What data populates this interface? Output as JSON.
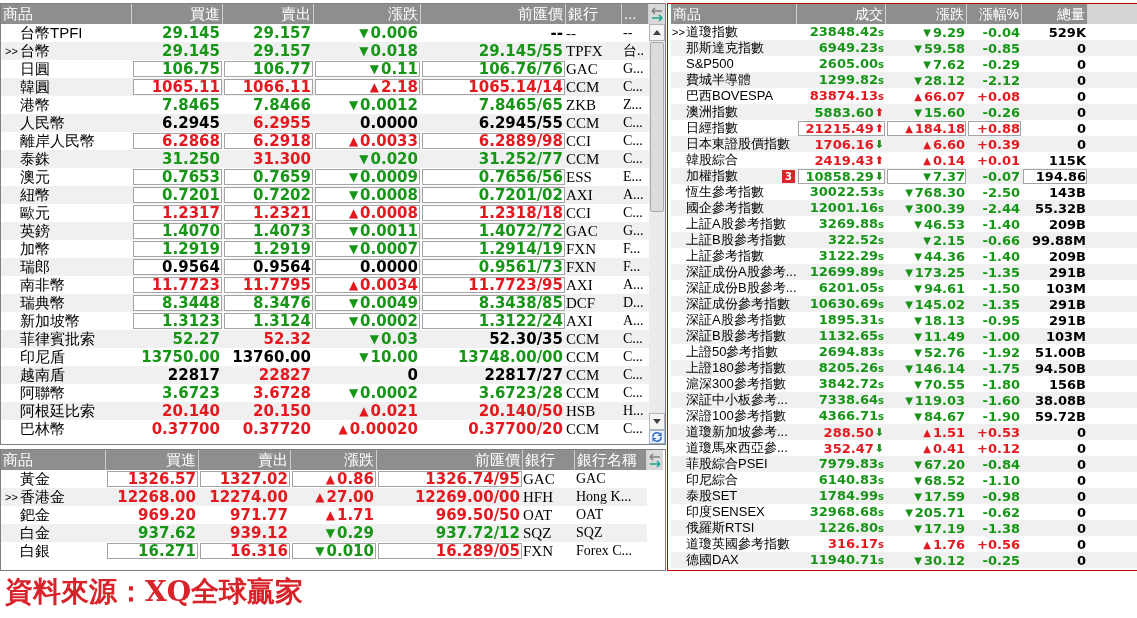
{
  "currency_table": {
    "columns": [
      "商品",
      "買進",
      "賣出",
      "漲跌",
      "前匯價",
      "銀行",
      "..."
    ],
    "selected_marker": ">>",
    "rows": [
      {
        "name": "台幣TPFI",
        "selected": false,
        "boxed": false,
        "bid": {
          "text": "29.145",
          "color": "#179517"
        },
        "ask": {
          "text": "29.157",
          "color": "#179517"
        },
        "change": {
          "text": "0.006",
          "arrow": "▼",
          "color": "#179517"
        },
        "prev": {
          "text": "--",
          "color": "#000000"
        },
        "bank": "--",
        "bank_name": "--"
      },
      {
        "name": "台幣",
        "selected": true,
        "boxed": false,
        "bid": {
          "text": "29.145",
          "color": "#179517"
        },
        "ask": {
          "text": "29.157",
          "color": "#179517"
        },
        "change": {
          "text": "0.018",
          "arrow": "▼",
          "color": "#179517"
        },
        "prev": {
          "text": "29.145/55",
          "color": "#179517"
        },
        "bank": "TPFX",
        "bank_name": "台.."
      },
      {
        "name": "日圓",
        "selected": false,
        "boxed": true,
        "bid": {
          "text": "106.75",
          "color": "#179517"
        },
        "ask": {
          "text": "106.77",
          "color": "#179517"
        },
        "change": {
          "text": "0.11",
          "arrow": "▼",
          "color": "#179517"
        },
        "prev": {
          "text": "106.76/76",
          "color": "#179517"
        },
        "bank": "GAC",
        "bank_name": "G..."
      },
      {
        "name": "韓圓",
        "selected": false,
        "boxed": true,
        "bid": {
          "text": "1065.11",
          "color": "#e3191f"
        },
        "ask": {
          "text": "1066.11",
          "color": "#e3191f"
        },
        "change": {
          "text": "2.18",
          "arrow": "▲",
          "color": "#e3191f"
        },
        "prev": {
          "text": "1065.14/14",
          "color": "#e3191f"
        },
        "bank": "CCM",
        "bank_name": "C..."
      },
      {
        "name": "港幣",
        "selected": false,
        "boxed": false,
        "bid": {
          "text": "7.8465",
          "color": "#179517"
        },
        "ask": {
          "text": "7.8466",
          "color": "#179517"
        },
        "change": {
          "text": "0.0012",
          "arrow": "▼",
          "color": "#179517"
        },
        "prev": {
          "text": "7.8465/65",
          "color": "#179517"
        },
        "bank": "ZKB",
        "bank_name": "Z..."
      },
      {
        "name": "人民幣",
        "selected": false,
        "boxed": false,
        "bid": {
          "text": "6.2945",
          "color": "#000000"
        },
        "ask": {
          "text": "6.2955",
          "color": "#e3191f"
        },
        "change": {
          "text": "0.0000",
          "color": "#000000"
        },
        "prev": {
          "text": "6.2945/55",
          "color": "#000000"
        },
        "bank": "CCM",
        "bank_name": "C..."
      },
      {
        "name": "離岸人民幣",
        "selected": false,
        "boxed": true,
        "bid": {
          "text": "6.2868",
          "color": "#e3191f"
        },
        "ask": {
          "text": "6.2918",
          "color": "#e3191f"
        },
        "change": {
          "text": "0.0033",
          "arrow": "▲",
          "color": "#e3191f"
        },
        "prev": {
          "text": "6.2889/98",
          "color": "#e3191f"
        },
        "bank": "CCI",
        "bank_name": "C..."
      },
      {
        "name": "泰銖",
        "selected": false,
        "boxed": false,
        "bid": {
          "text": "31.250",
          "color": "#179517"
        },
        "ask": {
          "text": "31.300",
          "color": "#e3191f"
        },
        "change": {
          "text": "0.020",
          "arrow": "▼",
          "color": "#179517"
        },
        "prev": {
          "text": "31.252/77",
          "color": "#179517"
        },
        "bank": "CCM",
        "bank_name": "C..."
      },
      {
        "name": "澳元",
        "selected": false,
        "boxed": true,
        "bid": {
          "text": "0.7653",
          "color": "#179517"
        },
        "ask": {
          "text": "0.7659",
          "color": "#179517"
        },
        "change": {
          "text": "0.0009",
          "arrow": "▼",
          "color": "#179517"
        },
        "prev": {
          "text": "0.7656/56",
          "color": "#179517"
        },
        "bank": "ESS",
        "bank_name": "E..."
      },
      {
        "name": "紐幣",
        "selected": false,
        "boxed": true,
        "bid": {
          "text": "0.7201",
          "color": "#179517"
        },
        "ask": {
          "text": "0.7202",
          "color": "#179517"
        },
        "change": {
          "text": "0.0008",
          "arrow": "▼",
          "color": "#179517"
        },
        "prev": {
          "text": "0.7201/02",
          "color": "#179517"
        },
        "bank": "AXI",
        "bank_name": "A..."
      },
      {
        "name": "歐元",
        "selected": false,
        "boxed": true,
        "bid": {
          "text": "1.2317",
          "color": "#e3191f"
        },
        "ask": {
          "text": "1.2321",
          "color": "#e3191f"
        },
        "change": {
          "text": "0.0008",
          "arrow": "▲",
          "color": "#e3191f"
        },
        "prev": {
          "text": "1.2318/18",
          "color": "#e3191f"
        },
        "bank": "CCI",
        "bank_name": "C..."
      },
      {
        "name": "英鎊",
        "selected": false,
        "boxed": true,
        "bid": {
          "text": "1.4070",
          "color": "#179517"
        },
        "ask": {
          "text": "1.4073",
          "color": "#179517"
        },
        "change": {
          "text": "0.0011",
          "arrow": "▼",
          "color": "#179517"
        },
        "prev": {
          "text": "1.4072/72",
          "color": "#179517"
        },
        "bank": "GAC",
        "bank_name": "G..."
      },
      {
        "name": "加幣",
        "selected": false,
        "boxed": true,
        "bid": {
          "text": "1.2919",
          "color": "#179517"
        },
        "ask": {
          "text": "1.2919",
          "color": "#179517"
        },
        "change": {
          "text": "0.0007",
          "arrow": "▼",
          "color": "#179517"
        },
        "prev": {
          "text": "1.2914/19",
          "color": "#179517"
        },
        "bank": "FXN",
        "bank_name": "F..."
      },
      {
        "name": "瑞郎",
        "selected": false,
        "boxed": true,
        "bid": {
          "text": "0.9564",
          "color": "#000000"
        },
        "ask": {
          "text": "0.9564",
          "color": "#000000"
        },
        "change": {
          "text": "0.0000",
          "color": "#000000"
        },
        "prev": {
          "text": "0.9561/73",
          "color": "#179517"
        },
        "bank": "FXN",
        "bank_name": "F..."
      },
      {
        "name": "南非幣",
        "selected": false,
        "boxed": true,
        "bid": {
          "text": "11.7723",
          "color": "#e3191f"
        },
        "ask": {
          "text": "11.7795",
          "color": "#e3191f"
        },
        "change": {
          "text": "0.0034",
          "arrow": "▲",
          "color": "#e3191f"
        },
        "prev": {
          "text": "11.7723/95",
          "color": "#e3191f"
        },
        "bank": "AXI",
        "bank_name": "A..."
      },
      {
        "name": "瑞典幣",
        "selected": false,
        "boxed": true,
        "bid": {
          "text": "8.3448",
          "color": "#179517"
        },
        "ask": {
          "text": "8.3476",
          "color": "#179517"
        },
        "change": {
          "text": "0.0049",
          "arrow": "▼",
          "color": "#179517"
        },
        "prev": {
          "text": "8.3438/85",
          "color": "#179517"
        },
        "bank": "DCF",
        "bank_name": "D..."
      },
      {
        "name": "新加坡幣",
        "selected": false,
        "boxed": true,
        "bid": {
          "text": "1.3123",
          "color": "#179517"
        },
        "ask": {
          "text": "1.3124",
          "color": "#179517"
        },
        "change": {
          "text": "0.0002",
          "arrow": "▼",
          "color": "#179517"
        },
        "prev": {
          "text": "1.3122/24",
          "color": "#179517"
        },
        "bank": "AXI",
        "bank_name": "A..."
      },
      {
        "name": "菲律賓批索",
        "selected": false,
        "boxed": false,
        "bid": {
          "text": "52.27",
          "color": "#179517"
        },
        "ask": {
          "text": "52.32",
          "color": "#e3191f"
        },
        "change": {
          "text": "0.03",
          "arrow": "▼",
          "color": "#179517"
        },
        "prev": {
          "text": "52.30/35",
          "color": "#000000"
        },
        "bank": "CCM",
        "bank_name": "C..."
      },
      {
        "name": "印尼盾",
        "selected": false,
        "boxed": false,
        "bid": {
          "text": "13750.00",
          "color": "#179517"
        },
        "ask": {
          "text": "13760.00",
          "color": "#000000"
        },
        "change": {
          "text": "10.00",
          "arrow": "▼",
          "color": "#179517"
        },
        "prev": {
          "text": "13748.00/00",
          "color": "#179517"
        },
        "bank": "CCM",
        "bank_name": "C..."
      },
      {
        "name": "越南盾",
        "selected": false,
        "boxed": false,
        "bid": {
          "text": "22817",
          "color": "#000000"
        },
        "ask": {
          "text": "22827",
          "color": "#e3191f"
        },
        "change": {
          "text": "0",
          "color": "#000000"
        },
        "prev": {
          "text": "22817/27",
          "color": "#000000"
        },
        "bank": "CCM",
        "bank_name": "C..."
      },
      {
        "name": "阿聯幣",
        "selected": false,
        "boxed": false,
        "bid": {
          "text": "3.6723",
          "color": "#179517"
        },
        "ask": {
          "text": "3.6728",
          "color": "#e3191f"
        },
        "change": {
          "text": "0.0002",
          "arrow": "▼",
          "color": "#179517"
        },
        "prev": {
          "text": "3.6723/28",
          "color": "#179517"
        },
        "bank": "CCM",
        "bank_name": "C..."
      },
      {
        "name": "阿根廷比索",
        "selected": false,
        "boxed": false,
        "bid": {
          "text": "20.140",
          "color": "#e3191f"
        },
        "ask": {
          "text": "20.150",
          "color": "#e3191f"
        },
        "change": {
          "text": "0.021",
          "arrow": "▲",
          "color": "#e3191f"
        },
        "prev": {
          "text": "20.140/50",
          "color": "#e3191f"
        },
        "bank": "HSB",
        "bank_name": "H..."
      },
      {
        "name": "巴林幣",
        "selected": false,
        "boxed": false,
        "bid": {
          "text": "0.37700",
          "color": "#e3191f"
        },
        "ask": {
          "text": "0.37720",
          "color": "#e3191f"
        },
        "change": {
          "text": "0.00020",
          "arrow": "▲",
          "color": "#e3191f"
        },
        "prev": {
          "text": "0.37700/20",
          "color": "#e3191f"
        },
        "bank": "CCM",
        "bank_name": "C..."
      }
    ]
  },
  "metals_table": {
    "columns": [
      "商品",
      "買進",
      "賣出",
      "漲跌",
      "前匯價",
      "銀行",
      "銀行名稱"
    ],
    "selected_marker": ">>",
    "rows": [
      {
        "name": "黃金",
        "selected": false,
        "boxed": true,
        "bid": {
          "text": "1326.57",
          "color": "#e3191f"
        },
        "ask": {
          "text": "1327.02",
          "color": "#e3191f"
        },
        "change": {
          "text": "0.86",
          "arrow": "▲",
          "color": "#e3191f"
        },
        "prev": {
          "text": "1326.74/95",
          "color": "#e3191f"
        },
        "bank": "GAC",
        "bank_name": "GAC"
      },
      {
        "name": "香港金",
        "selected": true,
        "boxed": false,
        "bid": {
          "text": "12268.00",
          "color": "#e3191f"
        },
        "ask": {
          "text": "12274.00",
          "color": "#e3191f"
        },
        "change": {
          "text": "27.00",
          "arrow": "▲",
          "color": "#e3191f"
        },
        "prev": {
          "text": "12269.00/00",
          "color": "#e3191f"
        },
        "bank": "HFH",
        "bank_name": "Hong K..."
      },
      {
        "name": "鈀金",
        "selected": false,
        "boxed": false,
        "bid": {
          "text": "969.20",
          "color": "#e3191f"
        },
        "ask": {
          "text": "971.77",
          "color": "#e3191f"
        },
        "change": {
          "text": "1.71",
          "arrow": "▲",
          "color": "#e3191f"
        },
        "prev": {
          "text": "969.50/50",
          "color": "#e3191f"
        },
        "bank": "OAT",
        "bank_name": "OAT"
      },
      {
        "name": "白金",
        "selected": false,
        "boxed": false,
        "bid": {
          "text": "937.62",
          "color": "#179517"
        },
        "ask": {
          "text": "939.12",
          "color": "#e3191f"
        },
        "change": {
          "text": "0.29",
          "arrow": "▼",
          "color": "#179517"
        },
        "prev": {
          "text": "937.72/12",
          "color": "#179517"
        },
        "bank": "SQZ",
        "bank_name": "SQZ"
      },
      {
        "name": "白銀",
        "selected": false,
        "boxed": true,
        "bid": {
          "text": "16.271",
          "color": "#179517"
        },
        "ask": {
          "text": "16.316",
          "color": "#e3191f"
        },
        "change": {
          "text": "0.010",
          "arrow": "▼",
          "color": "#179517"
        },
        "prev": {
          "text": "16.289/05",
          "color": "#e3191f"
        },
        "bank": "FXN",
        "bank_name": "Forex C..."
      }
    ]
  },
  "index_table": {
    "columns": [
      "商品",
      "成交",
      "漲跌",
      "漲幅%",
      "總量"
    ],
    "selected_marker": ">>",
    "rows": [
      {
        "name": "道瓊指數",
        "selected": true,
        "price": {
          "text": "23848.42",
          "color": "#179517",
          "suffix": "s"
        },
        "change": {
          "text": "9.29",
          "arrow": "▼",
          "color": "#179517"
        },
        "pct": {
          "text": "-0.04",
          "color": "#179517"
        },
        "volume": "529K"
      },
      {
        "name": "那斯達克指數",
        "selected": false,
        "price": {
          "text": "6949.23",
          "color": "#179517",
          "suffix": "s"
        },
        "change": {
          "text": "59.58",
          "arrow": "▼",
          "color": "#179517"
        },
        "pct": {
          "text": "-0.85",
          "color": "#179517"
        },
        "volume": "0"
      },
      {
        "name": "S&P500",
        "selected": false,
        "price": {
          "text": "2605.00",
          "color": "#179517",
          "suffix": "s"
        },
        "change": {
          "text": "7.62",
          "arrow": "▼",
          "color": "#179517"
        },
        "pct": {
          "text": "-0.29",
          "color": "#179517"
        },
        "volume": "0"
      },
      {
        "name": "費城半導體",
        "selected": false,
        "price": {
          "text": "1299.82",
          "color": "#179517",
          "suffix": "s"
        },
        "change": {
          "text": "28.12",
          "arrow": "▼",
          "color": "#179517"
        },
        "pct": {
          "text": "-2.12",
          "color": "#179517"
        },
        "volume": "0"
      },
      {
        "name": "巴西BOVESPA",
        "selected": false,
        "price": {
          "text": "83874.13",
          "color": "#e3191f",
          "suffix": "s"
        },
        "change": {
          "text": "66.07",
          "arrow": "▲",
          "color": "#e3191f"
        },
        "pct": {
          "text": "+0.08",
          "color": "#e3191f"
        },
        "volume": "0"
      },
      {
        "name": "澳洲指數",
        "selected": false,
        "price": {
          "text": "5883.60",
          "color": "#179517",
          "tick": {
            "text": "⬆",
            "color": "#e3191f"
          }
        },
        "change": {
          "text": "15.60",
          "arrow": "▼",
          "color": "#179517"
        },
        "pct": {
          "text": "-0.26",
          "color": "#179517"
        },
        "volume": "0"
      },
      {
        "name": "日經指數",
        "selected": false,
        "price": {
          "text": "21215.49",
          "color": "#e3191f",
          "boxed": true,
          "tick": {
            "text": "⬆",
            "color": "#e3191f"
          }
        },
        "change": {
          "text": "184.18",
          "arrow": "▲",
          "color": "#e3191f",
          "boxed": true
        },
        "pct": {
          "text": "+0.88",
          "color": "#e3191f",
          "boxed": true
        },
        "volume": "0"
      },
      {
        "name": "日本東證股價指數",
        "selected": false,
        "price": {
          "text": "1706.16",
          "color": "#e3191f",
          "tick": {
            "text": "⬇",
            "color": "#179517"
          }
        },
        "change": {
          "text": "6.60",
          "arrow": "▲",
          "color": "#e3191f"
        },
        "pct": {
          "text": "+0.39",
          "color": "#e3191f"
        },
        "volume": "0"
      },
      {
        "name": "韓股綜合",
        "selected": false,
        "price": {
          "text": "2419.43",
          "color": "#e3191f",
          "tick": {
            "text": "⬆",
            "color": "#e3191f"
          }
        },
        "change": {
          "text": "0.14",
          "arrow": "▲",
          "color": "#e3191f"
        },
        "pct": {
          "text": "+0.01",
          "color": "#e3191f"
        },
        "volume": "115K"
      },
      {
        "name": "加權指數",
        "selected": false,
        "badge": "3",
        "price": {
          "text": "10858.29",
          "color": "#179517",
          "boxed": true,
          "tick": {
            "text": "⬇",
            "color": "#179517"
          }
        },
        "change": {
          "text": "7.37",
          "arrow": "▼",
          "color": "#179517",
          "boxed": true
        },
        "pct": {
          "text": "-0.07",
          "color": "#179517"
        },
        "volume": "194.86",
        "volume_boxed": true
      },
      {
        "name": "恆生參考指數",
        "selected": false,
        "price": {
          "text": "30022.53",
          "color": "#179517",
          "suffix": "s"
        },
        "change": {
          "text": "768.30",
          "arrow": "▼",
          "color": "#179517"
        },
        "pct": {
          "text": "-2.50",
          "color": "#179517"
        },
        "volume": "143B"
      },
      {
        "name": "國企參考指數",
        "selected": false,
        "price": {
          "text": "12001.16",
          "color": "#179517",
          "suffix": "s"
        },
        "change": {
          "text": "300.39",
          "arrow": "▼",
          "color": "#179517"
        },
        "pct": {
          "text": "-2.44",
          "color": "#179517"
        },
        "volume": "55.32B"
      },
      {
        "name": "上証A股參考指數",
        "selected": false,
        "price": {
          "text": "3269.88",
          "color": "#179517",
          "suffix": "s"
        },
        "change": {
          "text": "46.53",
          "arrow": "▼",
          "color": "#179517"
        },
        "pct": {
          "text": "-1.40",
          "color": "#179517"
        },
        "volume": "209B"
      },
      {
        "name": "上証B股參考指數",
        "selected": false,
        "price": {
          "text": "322.52",
          "color": "#179517",
          "suffix": "s"
        },
        "change": {
          "text": "2.15",
          "arrow": "▼",
          "color": "#179517"
        },
        "pct": {
          "text": "-0.66",
          "color": "#179517"
        },
        "volume": "99.88M"
      },
      {
        "name": "上証參考指數",
        "selected": false,
        "price": {
          "text": "3122.29",
          "color": "#179517",
          "suffix": "s"
        },
        "change": {
          "text": "44.36",
          "arrow": "▼",
          "color": "#179517"
        },
        "pct": {
          "text": "-1.40",
          "color": "#179517"
        },
        "volume": "209B"
      },
      {
        "name": "深証成份A股參考...",
        "selected": false,
        "price": {
          "text": "12699.89",
          "color": "#179517",
          "suffix": "s"
        },
        "change": {
          "text": "173.25",
          "arrow": "▼",
          "color": "#179517"
        },
        "pct": {
          "text": "-1.35",
          "color": "#179517"
        },
        "volume": "291B"
      },
      {
        "name": "深証成份B股參考...",
        "selected": false,
        "price": {
          "text": "6201.05",
          "color": "#179517",
          "suffix": "s"
        },
        "change": {
          "text": "94.61",
          "arrow": "▼",
          "color": "#179517"
        },
        "pct": {
          "text": "-1.50",
          "color": "#179517"
        },
        "volume": "103M"
      },
      {
        "name": "深証成份參考指數",
        "selected": false,
        "price": {
          "text": "10630.69",
          "color": "#179517",
          "suffix": "s"
        },
        "change": {
          "text": "145.02",
          "arrow": "▼",
          "color": "#179517"
        },
        "pct": {
          "text": "-1.35",
          "color": "#179517"
        },
        "volume": "291B"
      },
      {
        "name": "深証A股參考指數",
        "selected": false,
        "price": {
          "text": "1895.31",
          "color": "#179517",
          "suffix": "s"
        },
        "change": {
          "text": "18.13",
          "arrow": "▼",
          "color": "#179517"
        },
        "pct": {
          "text": "-0.95",
          "color": "#179517"
        },
        "volume": "291B"
      },
      {
        "name": "深証B股參考指數",
        "selected": false,
        "price": {
          "text": "1132.65",
          "color": "#179517",
          "suffix": "s"
        },
        "change": {
          "text": "11.49",
          "arrow": "▼",
          "color": "#179517"
        },
        "pct": {
          "text": "-1.00",
          "color": "#179517"
        },
        "volume": "103M"
      },
      {
        "name": "上證50參考指數",
        "selected": false,
        "price": {
          "text": "2694.83",
          "color": "#179517",
          "suffix": "s"
        },
        "change": {
          "text": "52.76",
          "arrow": "▼",
          "color": "#179517"
        },
        "pct": {
          "text": "-1.92",
          "color": "#179517"
        },
        "volume": "51.00B"
      },
      {
        "name": "上證180參考指數",
        "selected": false,
        "price": {
          "text": "8205.26",
          "color": "#179517",
          "suffix": "s"
        },
        "change": {
          "text": "146.14",
          "arrow": "▼",
          "color": "#179517"
        },
        "pct": {
          "text": "-1.75",
          "color": "#179517"
        },
        "volume": "94.50B"
      },
      {
        "name": "滬深300參考指數",
        "selected": false,
        "price": {
          "text": "3842.72",
          "color": "#179517",
          "suffix": "s"
        },
        "change": {
          "text": "70.55",
          "arrow": "▼",
          "color": "#179517"
        },
        "pct": {
          "text": "-1.80",
          "color": "#179517"
        },
        "volume": "156B"
      },
      {
        "name": "深証中小板參考...",
        "selected": false,
        "price": {
          "text": "7338.64",
          "color": "#179517",
          "suffix": "s"
        },
        "change": {
          "text": "119.03",
          "arrow": "▼",
          "color": "#179517"
        },
        "pct": {
          "text": "-1.60",
          "color": "#179517"
        },
        "volume": "38.08B"
      },
      {
        "name": "深證100參考指數",
        "selected": false,
        "price": {
          "text": "4366.71",
          "color": "#179517",
          "suffix": "s"
        },
        "change": {
          "text": "84.67",
          "arrow": "▼",
          "color": "#179517"
        },
        "pct": {
          "text": "-1.90",
          "color": "#179517"
        },
        "volume": "59.72B"
      },
      {
        "name": "道瓊新加坡參考...",
        "selected": false,
        "price": {
          "text": "288.50",
          "color": "#e3191f",
          "tick": {
            "text": "⬇",
            "color": "#179517"
          }
        },
        "change": {
          "text": "1.51",
          "arrow": "▲",
          "color": "#e3191f"
        },
        "pct": {
          "text": "+0.53",
          "color": "#e3191f"
        },
        "volume": "0"
      },
      {
        "name": "道瓊馬來西亞參...",
        "selected": false,
        "price": {
          "text": "352.47",
          "color": "#e3191f",
          "tick": {
            "text": "⬇",
            "color": "#179517"
          }
        },
        "change": {
          "text": "0.41",
          "arrow": "▲",
          "color": "#e3191f"
        },
        "pct": {
          "text": "+0.12",
          "color": "#e3191f"
        },
        "volume": "0"
      },
      {
        "name": "菲股綜合PSEI",
        "selected": false,
        "price": {
          "text": "7979.83",
          "color": "#179517",
          "suffix": "s"
        },
        "change": {
          "text": "67.20",
          "arrow": "▼",
          "color": "#179517"
        },
        "pct": {
          "text": "-0.84",
          "color": "#179517"
        },
        "volume": "0"
      },
      {
        "name": "印尼綜合",
        "selected": false,
        "price": {
          "text": "6140.83",
          "color": "#179517",
          "suffix": "s"
        },
        "change": {
          "text": "68.52",
          "arrow": "▼",
          "color": "#179517"
        },
        "pct": {
          "text": "-1.10",
          "color": "#179517"
        },
        "volume": "0"
      },
      {
        "name": "泰股SET",
        "selected": false,
        "price": {
          "text": "1784.99",
          "color": "#179517",
          "suffix": "s"
        },
        "change": {
          "text": "17.59",
          "arrow": "▼",
          "color": "#179517"
        },
        "pct": {
          "text": "-0.98",
          "color": "#179517"
        },
        "volume": "0"
      },
      {
        "name": "印度SENSEX",
        "selected": false,
        "price": {
          "text": "32968.68",
          "color": "#179517",
          "suffix": "s"
        },
        "change": {
          "text": "205.71",
          "arrow": "▼",
          "color": "#179517"
        },
        "pct": {
          "text": "-0.62",
          "color": "#179517"
        },
        "volume": "0"
      },
      {
        "name": "俄羅斯RTSI",
        "selected": false,
        "price": {
          "text": "1226.80",
          "color": "#179517",
          "suffix": "s"
        },
        "change": {
          "text": "17.19",
          "arrow": "▼",
          "color": "#179517"
        },
        "pct": {
          "text": "-1.38",
          "color": "#179517"
        },
        "volume": "0"
      },
      {
        "name": "道瓊英國參考指數",
        "selected": false,
        "price": {
          "text": "316.17",
          "color": "#e3191f",
          "suffix": "s"
        },
        "change": {
          "text": "1.76",
          "arrow": "▲",
          "color": "#e3191f"
        },
        "pct": {
          "text": "+0.56",
          "color": "#e3191f"
        },
        "volume": "0"
      },
      {
        "name": "德國DAX",
        "selected": false,
        "price": {
          "text": "11940.71",
          "color": "#179517",
          "suffix": "s"
        },
        "change": {
          "text": "30.12",
          "arrow": "▼",
          "color": "#179517"
        },
        "pct": {
          "text": "-0.25",
          "color": "#179517"
        },
        "volume": "0"
      }
    ]
  },
  "source": "資料來源：XQ全球贏家"
}
